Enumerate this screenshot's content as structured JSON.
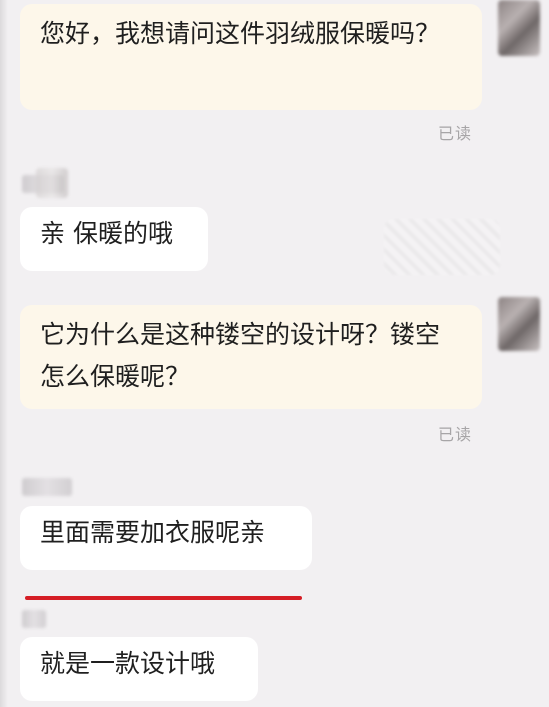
{
  "messages": [
    {
      "side": "out",
      "text": "您好，我想请问这件羽绒服保暖吗？",
      "status": "已读"
    },
    {
      "side": "in",
      "text": "亲 保暖的哦"
    },
    {
      "side": "out",
      "text": "它为什么是这种镂空的设计呀？镂空怎么保暖呢？",
      "status": "已读"
    },
    {
      "side": "in",
      "text": "里面需要加衣服呢亲"
    },
    {
      "side": "in",
      "text": "就是一款设计哦"
    }
  ],
  "colors": {
    "outgoing_bubble": "#fdf7ea",
    "incoming_bubble": "#ffffff",
    "background": "#f2f0f2",
    "underline": "#d51d25"
  }
}
